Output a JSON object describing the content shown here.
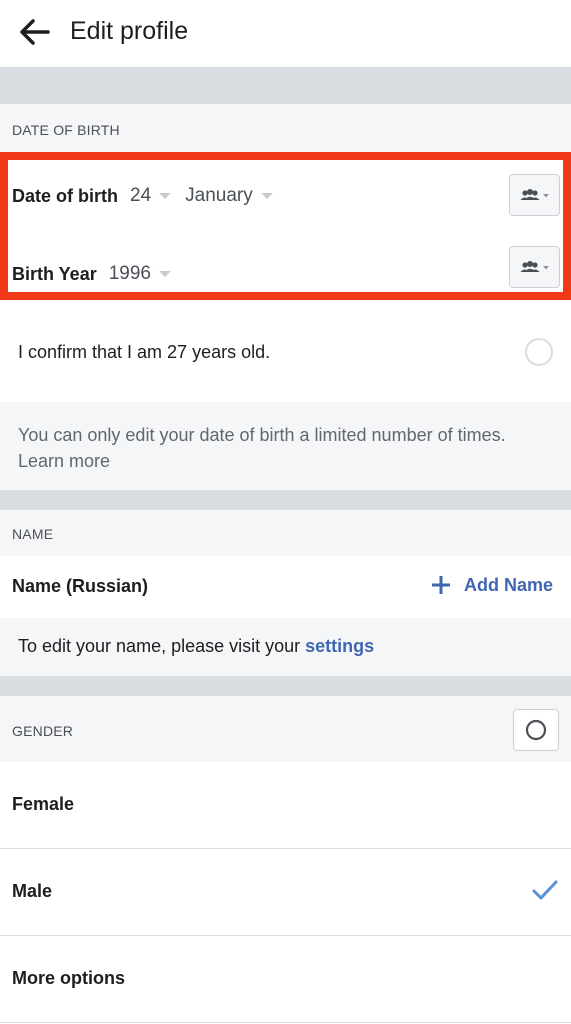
{
  "header": {
    "title": "Edit profile"
  },
  "dob_section": {
    "label": "DATE OF BIRTH",
    "date_label": "Date of birth",
    "day_value": "24",
    "month_value": "January",
    "year_label": "Birth Year",
    "year_value": "1996",
    "confirm_text": "I confirm that I am 27 years old.",
    "info_text": "You can only edit your date of birth a limited number of times. Learn more"
  },
  "name_section": {
    "label": "NAME",
    "name_label": "Name (Russian)",
    "add_name_label": "Add Name",
    "edit_note_prefix": "To edit your name, please visit your",
    "edit_note_link": "settings"
  },
  "gender_section": {
    "label": "GENDER",
    "options": [
      {
        "label": "Female",
        "selected": false
      },
      {
        "label": "Male",
        "selected": true
      },
      {
        "label": "More options",
        "selected": false
      }
    ]
  },
  "colors": {
    "highlight_border": "#f03a17",
    "link_blue": "#4267b2",
    "check_blue": "#5b8fd9"
  }
}
